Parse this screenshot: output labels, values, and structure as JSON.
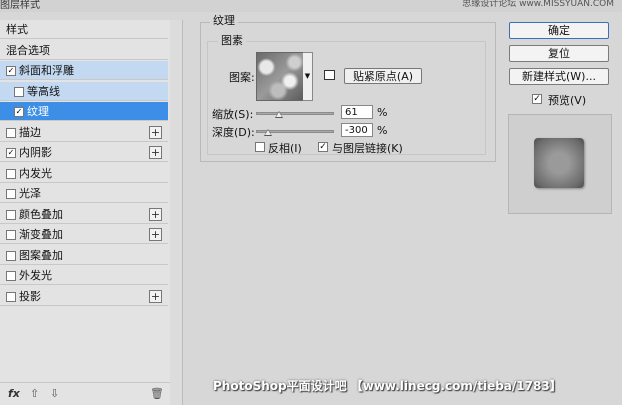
{
  "window": {
    "title": "图层样式",
    "corner_text": "思缘设计论坛 www.MISSYUAN.COM"
  },
  "sidebar": {
    "items": [
      {
        "label": "样式",
        "checkbox": false,
        "checked": false,
        "plus": false,
        "state": "normal"
      },
      {
        "label": "混合选项",
        "checkbox": false,
        "checked": false,
        "plus": false,
        "state": "normal"
      },
      {
        "label": "斜面和浮雕",
        "checkbox": true,
        "checked": true,
        "plus": false,
        "state": "parent-selected"
      },
      {
        "label": "等高线",
        "checkbox": true,
        "checked": false,
        "plus": false,
        "state": "parent-selected"
      },
      {
        "label": "纹理",
        "checkbox": true,
        "checked": true,
        "plus": false,
        "state": "selected"
      },
      {
        "label": "描边",
        "checkbox": true,
        "checked": false,
        "plus": true,
        "state": "normal"
      },
      {
        "label": "内阴影",
        "checkbox": true,
        "checked": true,
        "plus": true,
        "state": "normal"
      },
      {
        "label": "内发光",
        "checkbox": true,
        "checked": false,
        "plus": false,
        "state": "normal"
      },
      {
        "label": "光泽",
        "checkbox": true,
        "checked": false,
        "plus": false,
        "state": "normal"
      },
      {
        "label": "颜色叠加",
        "checkbox": true,
        "checked": false,
        "plus": true,
        "state": "normal"
      },
      {
        "label": "渐变叠加",
        "checkbox": true,
        "checked": false,
        "plus": true,
        "state": "normal"
      },
      {
        "label": "图案叠加",
        "checkbox": true,
        "checked": false,
        "plus": false,
        "state": "normal"
      },
      {
        "label": "外发光",
        "checkbox": true,
        "checked": false,
        "plus": false,
        "state": "normal"
      },
      {
        "label": "投影",
        "checkbox": true,
        "checked": false,
        "plus": true,
        "state": "normal"
      }
    ],
    "footer": {
      "fx": "fx",
      "up_icon": "arrow-up-icon",
      "down_icon": "arrow-down-icon",
      "trash_icon": "trash-icon"
    }
  },
  "texture": {
    "group_title": "纹理",
    "inner_title": "图素",
    "pattern_label": "图案:",
    "snap_button": "贴紧原点(A)",
    "scale_label": "缩放(S):",
    "scale_value": "61",
    "scale_fraction": 0.3,
    "depth_label": "深度(D):",
    "depth_value": "-300",
    "depth_fraction": 0.15,
    "percent": "%",
    "invert_label": "反相(I)",
    "invert_checked": false,
    "link_label": "与图层链接(K)",
    "link_checked": true
  },
  "actions": {
    "ok": "确定",
    "cancel": "复位",
    "new_style": "新建样式(W)...",
    "preview_label": "预览(V)",
    "preview_checked": true
  },
  "watermark": "PhotoShop平面设计吧 【www.linecg.com/tieba/1783】",
  "colors": {
    "selected": "#3d8ee6",
    "parent_selected": "#c2d9f1",
    "panel": "#d7d7d7"
  }
}
